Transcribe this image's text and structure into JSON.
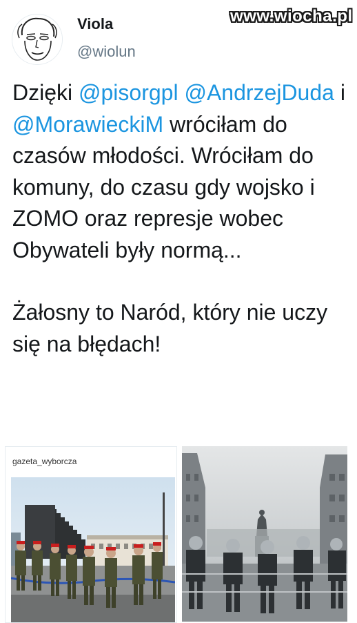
{
  "watermark": "www.wiocha.pl",
  "author": {
    "name": "Viola",
    "handle": "@wiolun",
    "avatar_icon": "sketched-face-avatar"
  },
  "tweet": {
    "w1": "Dzięki",
    "m1": "@pisorgpl",
    "m2": "@AndrzejDuda",
    "w2": "i",
    "m3": "@MorawieckiM",
    "w3": "wróciłam do czasów młodości. Wróciłam do komuny, do czasu gdy wojsko i ZOMO oraz represje wobec Obywateli były normą...",
    "p2": "Żałosny to Naród, który nie uczy się na błędach!"
  },
  "media": {
    "left_source": "gazeta_wyborcza",
    "left_image": "soldiers-in-red-berets-at-smolensk-monument",
    "right_image": "riot-police-line-at-statue-monochrome"
  },
  "colors": {
    "mention": "#1b95e0",
    "text": "#14171a",
    "secondary": "#657786"
  }
}
